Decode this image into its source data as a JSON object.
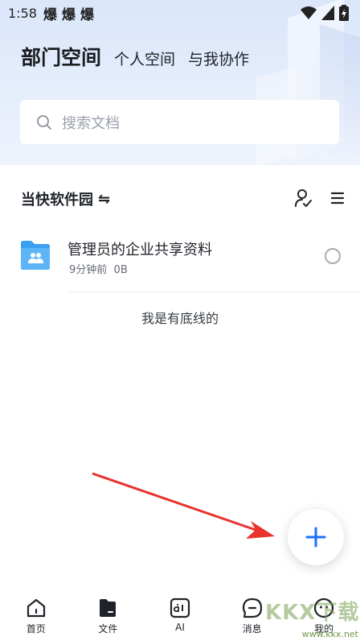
{
  "status_bar": {
    "time": "1:58",
    "notifications": [
      "爆",
      "爆",
      "爆"
    ]
  },
  "header": {
    "title": "部门空间",
    "tabs": [
      "个人空间",
      "与我协作"
    ]
  },
  "search": {
    "placeholder": "搜索文档"
  },
  "section": {
    "title": "当快软件园",
    "swap_symbol": "⇋"
  },
  "files": [
    {
      "name": "管理员的企业共享资料",
      "time": "9分钟前",
      "size": "0B"
    }
  ],
  "list_footer": "我是有底线的",
  "tab_bar": {
    "items": [
      {
        "label": "首页",
        "icon": "home-icon"
      },
      {
        "label": "文件",
        "icon": "file-icon"
      },
      {
        "label": "AI",
        "icon": "ai-icon"
      },
      {
        "label": "消息",
        "icon": "message-icon"
      },
      {
        "label": "我的",
        "icon": "profile-icon"
      }
    ]
  },
  "watermark": {
    "brand": "KKX下载",
    "url": "www.kkx.net"
  },
  "colors": {
    "accent": "#1e6fff",
    "folder": "#3aa0f3",
    "annotation_arrow": "#e8332e"
  }
}
